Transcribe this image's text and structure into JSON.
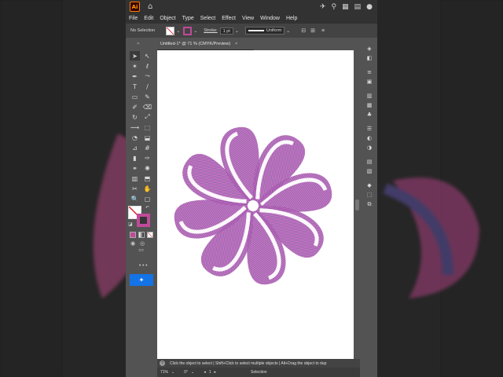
{
  "app": {
    "logo": "Ai",
    "home_icon": "home-icon",
    "title_icons": [
      "share-icon",
      "search-icon",
      "layout-icon",
      "panel-icon",
      "user-icon"
    ]
  },
  "menu": [
    "File",
    "Edit",
    "Object",
    "Type",
    "Select",
    "Effect",
    "View",
    "Window",
    "Help"
  ],
  "control_bar": {
    "selection_label": "No Selection",
    "stroke_label": "Stroke:",
    "stroke_value": "1 pt",
    "profile_label": "Uniform"
  },
  "document_tab": {
    "title": "Untitled-1* @ 71 % (CMYK/Preview)",
    "close": "×"
  },
  "hint": {
    "text": "Click the object to select  |  Shift+Click to select multiple objects  |  Alt+Drag the object to dup"
  },
  "status_bar": {
    "zoom": "71%",
    "rotation": "0°",
    "artboard_nav": "1",
    "tool": "Selection"
  },
  "colors": {
    "accent": "#1473e6",
    "stroke_swatch": "#c04a9a",
    "flower_magenta": "#d63fa2",
    "flower_blue": "#3c5bb5"
  },
  "tools": [
    "selection-tool-icon",
    "direct-selection-tool-icon",
    "magic-wand-icon",
    "lasso-icon",
    "pen-icon",
    "curvature-icon",
    "type-icon",
    "line-icon",
    "rectangle-icon",
    "paintbrush-icon",
    "shaper-icon",
    "eraser-icon",
    "rotate-icon",
    "scale-icon",
    "width-icon",
    "free-transform-icon",
    "shape-builder-icon",
    "live-paint-icon",
    "perspective-icon",
    "mesh-icon",
    "gradient-icon",
    "eyedropper-icon",
    "blend-icon",
    "symbol-sprayer-icon",
    "graph-icon",
    "artboard-icon",
    "slice-icon",
    "hand-icon",
    "zoom-icon",
    "print-tiling-icon"
  ]
}
